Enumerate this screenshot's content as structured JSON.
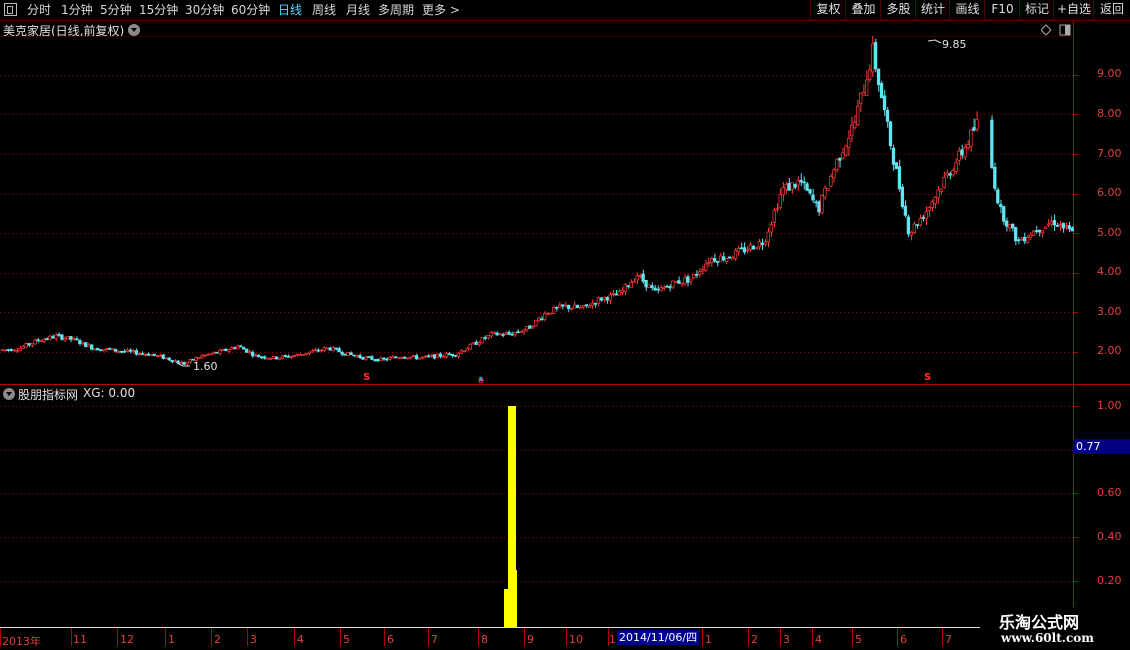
{
  "toolbar": {
    "periods": [
      "分时",
      "1分钟",
      "5分钟",
      "15分钟",
      "30分钟",
      "60分钟",
      "日线",
      "周线",
      "月线",
      "多周期",
      "更多 >"
    ],
    "active_period": "日线",
    "buttons": [
      "复权",
      "叠加",
      "多股",
      "统计",
      "画线",
      "F10",
      "标记",
      "+自选",
      "返回"
    ]
  },
  "price_panel": {
    "title": "美克家居(日线,前复权)",
    "y_ticks": [
      "9.00",
      "8.00",
      "7.00",
      "6.00",
      "5.00",
      "4.00",
      "3.00",
      "2.00"
    ],
    "high_label": "9.85",
    "low_label": "1.60",
    "signal_marks": [
      "S",
      "S",
      "S"
    ],
    "colors": {
      "up": "#ff3c3c",
      "down": "#5fe6f0",
      "grid": "#8b0000",
      "axis": "#b40000"
    }
  },
  "indicator_panel": {
    "title": "股朋指标网",
    "series_label": "XG: 0.00",
    "y_ticks": [
      "1.00",
      "0.60",
      "0.40",
      "0.20"
    ],
    "cursor_value": "0.77",
    "bar_color": "#ffff00"
  },
  "x_axis": {
    "labels": [
      "2013年",
      "11",
      "12",
      "1",
      "2",
      "3",
      "4",
      "5",
      "6",
      "7",
      "8",
      "9",
      "10",
      "1",
      "1",
      "2",
      "3",
      "4",
      "5",
      "6",
      "7"
    ],
    "cursor_date": "2014/11/06/四"
  },
  "watermark": {
    "title": "乐淘公式网",
    "url": "www.60lt.com"
  },
  "chart_data": [
    {
      "type": "candlestick",
      "title": "美克家居(日线,前复权)",
      "ylim": [
        1.4,
        10.3
      ],
      "x_labels": [
        "2013年",
        "11",
        "12",
        "1",
        "2",
        "3",
        "4",
        "5",
        "6",
        "7",
        "8",
        "9",
        "10",
        "1",
        "1",
        "2",
        "3",
        "4",
        "5",
        "6",
        "7"
      ],
      "price_path": [
        2.05,
        2.1,
        2.3,
        2.4,
        2.3,
        2.1,
        2.05,
        2.0,
        1.95,
        1.85,
        1.7,
        1.9,
        2.0,
        2.15,
        1.9,
        1.85,
        1.9,
        2.0,
        2.1,
        1.95,
        1.85,
        1.8,
        1.9,
        1.85,
        1.9,
        1.95,
        2.2,
        2.45,
        2.45,
        2.6,
        3.0,
        3.15,
        3.1,
        3.35,
        3.45,
        3.95,
        3.5,
        3.75,
        3.85,
        4.35,
        4.4,
        4.6,
        4.8,
        6.1,
        6.3,
        5.6,
        6.8,
        7.8,
        9.6,
        7.2,
        5.0,
        5.6,
        6.4,
        7.1,
        8.0,
        5.6,
        4.8,
        5.1,
        5.3,
        5.0
      ],
      "high": 9.85,
      "low": 1.6,
      "signals": [
        "S",
        "B",
        "S"
      ]
    },
    {
      "type": "bar",
      "title": "股朋指标网",
      "series": [
        {
          "name": "XG",
          "values": [
            1.0
          ]
        }
      ],
      "ylim": [
        0,
        1.05
      ],
      "y_ticks": [
        1.0,
        0.6,
        0.4,
        0.2
      ],
      "current_value": 0.0
    }
  ]
}
